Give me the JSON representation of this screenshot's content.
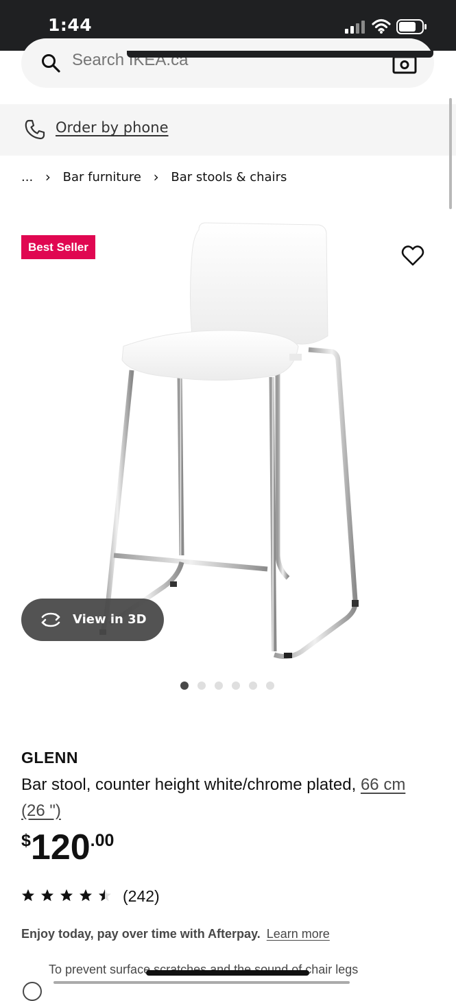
{
  "status_bar": {
    "time": "1:44"
  },
  "search": {
    "placeholder": "Search IKEA.ca"
  },
  "phone": {
    "label": "Order by phone"
  },
  "breadcrumb": {
    "ellipsis": "...",
    "items": [
      "Bar furniture",
      "Bar stools & chairs"
    ],
    "separator": "›"
  },
  "product": {
    "badge": "Best Seller",
    "view3d_label": "View in 3D",
    "image_count": 6,
    "active_image": 1,
    "name": "GLENN",
    "description": "Bar stool, counter height white/chrome plated,",
    "size": "66 cm (26 \")",
    "price": {
      "currency": "$",
      "whole": "120",
      "decimal": ".00"
    },
    "rating": {
      "value": 4.5,
      "max": 5,
      "count": "(242)"
    }
  },
  "afterpay": {
    "text": "Enjoy today, pay over time with Afterpay.",
    "link": "Learn more"
  },
  "tip": {
    "line1": "To prevent surface scratches and the sound of chair legs"
  },
  "colors": {
    "badge": "#e00751",
    "status_bar": "#1f2022",
    "search_bg": "#f5f5f5",
    "text": "#111111"
  },
  "icons": [
    "search-icon",
    "camera-icon",
    "phone-icon",
    "heart-icon",
    "rotate-icon",
    "star-icon"
  ]
}
